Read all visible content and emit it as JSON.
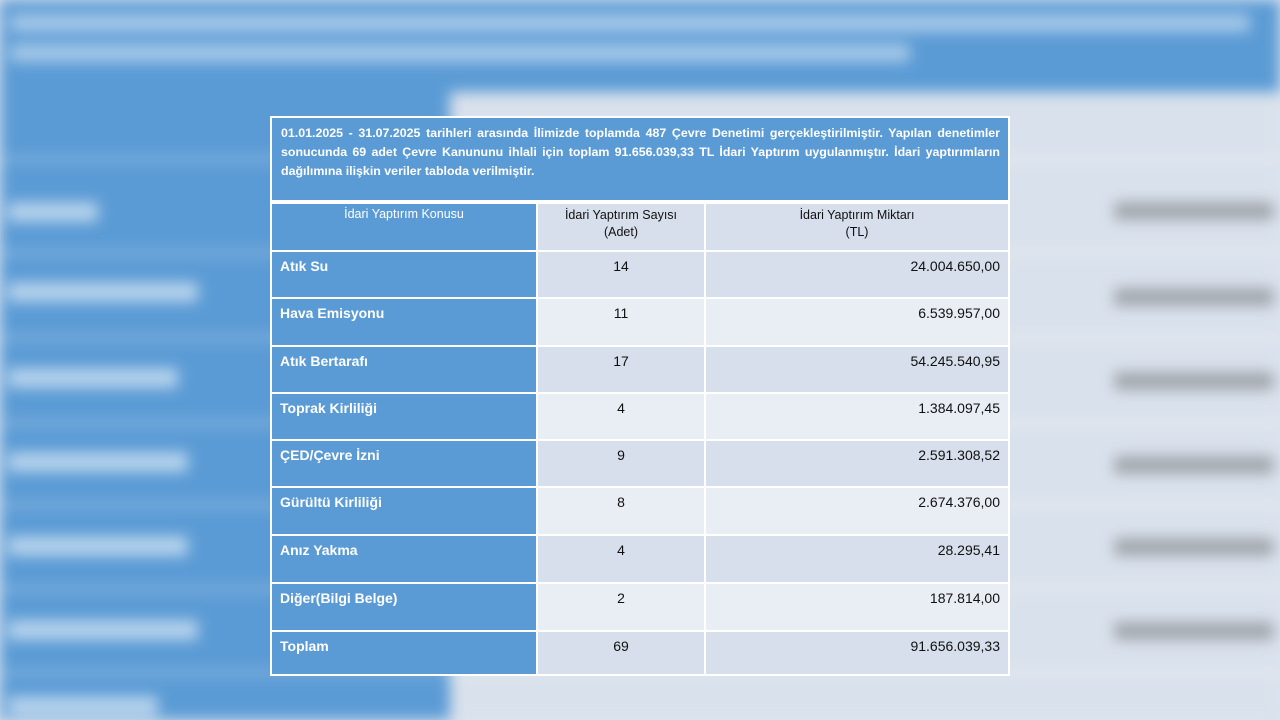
{
  "intro": "01.01.2025 - 31.07.2025 tarihleri arasında İlimizde toplamda 487 Çevre Denetimi gerçekleştirilmiştir. Yapılan denetimler sonucunda 69 adet Çevre Kanununu ihlali için toplam 91.656.039,33 TL İdari Yaptırım uygulanmıştır. İdari yaptırımların dağılımına ilişkin veriler tabloda verilmiştir.",
  "table": {
    "headers": {
      "konu": "İdari Yaptırım Konusu",
      "sayi_line1": "İdari Yaptırım Sayısı",
      "sayi_line2": "(Adet)",
      "miktar_line1": "İdari Yaptırım Miktarı",
      "miktar_line2": "(TL)"
    },
    "rows": [
      {
        "konu": "Atık Su",
        "sayi": "14",
        "miktar": "24.004.650,00"
      },
      {
        "konu": "Hava Emisyonu",
        "sayi": "11",
        "miktar": "6.539.957,00"
      },
      {
        "konu": "Atık Bertarafı",
        "sayi": "17",
        "miktar": "54.245.540,95"
      },
      {
        "konu": "Toprak Kirliliği",
        "sayi": "4",
        "miktar": "1.384.097,45"
      },
      {
        "konu": "ÇED/Çevre İzni",
        "sayi": "9",
        "miktar": "2.591.308,52"
      },
      {
        "konu": "Gürültü Kirliliği",
        "sayi": "8",
        "miktar": "2.674.376,00"
      },
      {
        "konu": "Anız Yakma",
        "sayi": "4",
        "miktar": "28.295,41"
      },
      {
        "konu": "Diğer(Bilgi Belge)",
        "sayi": "2",
        "miktar": "187.814,00"
      },
      {
        "konu": "Toplam",
        "sayi": "69",
        "miktar": "91.656.039,33"
      }
    ]
  },
  "colors": {
    "header_blue": "#5b9bd5",
    "cell_light": "#d6dfeb",
    "cell_lighter": "#e9eef5"
  }
}
